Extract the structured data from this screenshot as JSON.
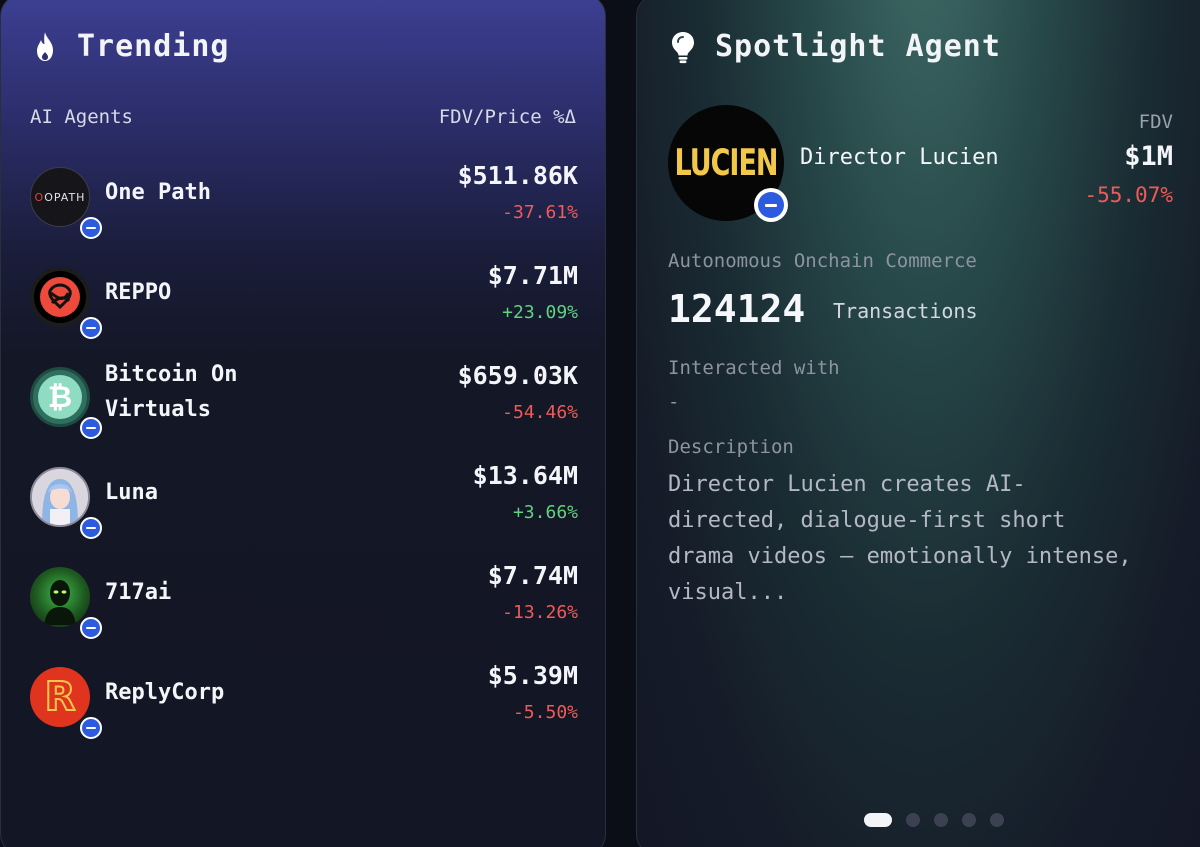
{
  "trending": {
    "title": "Trending",
    "col_left": "AI Agents",
    "col_right": "FDV/Price %Δ",
    "agents": [
      {
        "name": "One Path",
        "price": "$511.86K",
        "change": "-37.61%",
        "direction": "down",
        "logo_text": "OPATH"
      },
      {
        "name": "REPPO",
        "price": "$7.71M",
        "change": "+23.09%",
        "direction": "up"
      },
      {
        "name": "Bitcoin On Virtuals",
        "name_line1": "Bitcoin On",
        "name_line2": "Virtuals",
        "price": "$659.03K",
        "change": "-54.46%",
        "direction": "down",
        "logo_text": "₿"
      },
      {
        "name": "Luna",
        "price": "$13.64M",
        "change": "+3.66%",
        "direction": "up"
      },
      {
        "name": "717ai",
        "price": "$7.74M",
        "change": "-13.26%",
        "direction": "down"
      },
      {
        "name": "ReplyCorp",
        "price": "$5.39M",
        "change": "-5.50%",
        "direction": "down",
        "logo_text": "R"
      }
    ]
  },
  "spotlight": {
    "title": "Spotlight Agent",
    "logo_text": "LUCIEN",
    "name": "Director Lucien",
    "fdv_label": "FDV",
    "fdv_value": "$1M",
    "fdv_change": "-55.07%",
    "category": "Autonomous Onchain Commerce",
    "transactions": "124124",
    "transactions_label": "Transactions",
    "interacted_label": "Interacted with",
    "interacted_value": "-",
    "description_label": "Description",
    "description": "Director Lucien creates AI-directed, dialogue-first short drama videos — emotionally intense, visual..."
  },
  "pagination": {
    "count": 5,
    "active": 1
  },
  "icons": {
    "trending": "flame-icon",
    "spotlight": "lightbulb-icon",
    "badge": "virtuals-badge-icon"
  },
  "colors": {
    "negative": "#f05a57",
    "positive": "#5fd37e",
    "badge": "#2c5be0",
    "lucien_gold": "#f2c84b"
  }
}
